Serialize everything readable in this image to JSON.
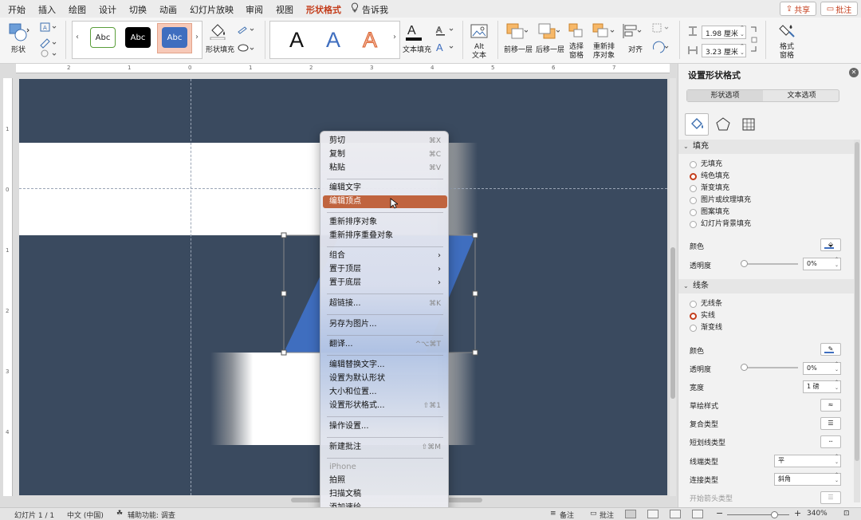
{
  "tabs": [
    "开始",
    "插入",
    "绘图",
    "设计",
    "切换",
    "动画",
    "幻灯片放映",
    "审阅",
    "视图",
    "形状格式",
    "告诉我"
  ],
  "active_tab": "形状格式",
  "header_buttons": {
    "share": "共享",
    "comment": "批注"
  },
  "ribbon": {
    "shape_label": "形状",
    "style_swatches": [
      "Abc",
      "Abc",
      "Abc"
    ],
    "shape_fill_label": "形状填充",
    "wordart_letters": [
      "A",
      "A",
      "A"
    ],
    "text_fill_label": "文本填充",
    "alt_text_label": [
      "Alt",
      "文本"
    ],
    "bring_forward": "前移一层",
    "send_backward": "后移一层",
    "selection_pane": [
      "选择",
      "窗格"
    ],
    "reorder_objects": [
      "重新排",
      "序对象"
    ],
    "align": "对齐",
    "height_value": "1.98 厘米",
    "width_value": "3.23 厘米",
    "format_pane": [
      "格式",
      "窗格"
    ],
    "accent_color": "#c43e1c"
  },
  "context_menu": {
    "items": [
      {
        "label": "剪切",
        "shortcut": "⌘X"
      },
      {
        "label": "复制",
        "shortcut": "⌘C"
      },
      {
        "label": "粘贴",
        "shortcut": "⌘V"
      },
      {
        "label": "编辑文字",
        "shortcut": ""
      },
      {
        "label": "编辑顶点",
        "shortcut": "",
        "highlighted": true
      },
      {
        "label": "重新排序对象",
        "shortcut": ""
      },
      {
        "label": "重新排序重叠对象",
        "shortcut": ""
      },
      {
        "label": "组合",
        "shortcut": "",
        "submenu": true
      },
      {
        "label": "置于顶层",
        "shortcut": "",
        "submenu": true
      },
      {
        "label": "置于底层",
        "shortcut": "",
        "submenu": true
      },
      {
        "label": "超链接...",
        "shortcut": "⌘K"
      },
      {
        "label": "另存为图片...",
        "shortcut": ""
      },
      {
        "label": "翻译...",
        "shortcut": "^⌥⌘T"
      },
      {
        "label": "编辑替换文字...",
        "shortcut": ""
      },
      {
        "label": "设置为默认形状",
        "shortcut": ""
      },
      {
        "label": "大小和位置...",
        "shortcut": ""
      },
      {
        "label": "设置形状格式...",
        "shortcut": "⇧⌘1"
      },
      {
        "label": "操作设置...",
        "shortcut": ""
      },
      {
        "label": "新建批注",
        "shortcut": "⇧⌘M"
      },
      {
        "label": "iPhone",
        "shortcut": "",
        "disabled": true
      },
      {
        "label": "拍照",
        "shortcut": ""
      },
      {
        "label": "扫描文稿",
        "shortcut": ""
      },
      {
        "label": "添加速绘",
        "shortcut": ""
      }
    ]
  },
  "format_pane": {
    "title": "设置形状格式",
    "tabs": [
      "形状选项",
      "文本选项"
    ],
    "fill": {
      "header": "填充",
      "options": [
        "无填充",
        "纯色填充",
        "渐变填充",
        "图片或纹理填充",
        "图案填充",
        "幻灯片背景填充"
      ],
      "selected": 1,
      "color_label": "颜色",
      "transparency_label": "透明度",
      "transparency_value": "0%"
    },
    "line": {
      "header": "线条",
      "options": [
        "无线条",
        "实线",
        "渐变线"
      ],
      "selected": 1,
      "color_label": "颜色",
      "transparency_label": "透明度",
      "transparency_value": "0%",
      "width_label": "宽度",
      "width_value": "1 磅",
      "sketch_label": "草绘样式",
      "compound_label": "复合类型",
      "dash_label": "短划线类型",
      "cap_label": "线端类型",
      "cap_value": "平",
      "join_label": "连接类型",
      "join_value": "斜角",
      "arrow_label": "开始箭头类型"
    }
  },
  "status_bar": {
    "slide_info": "幻灯片 1 / 1",
    "language": "中文 (中国)",
    "accessibility": "辅助功能: 调查",
    "notes": "备注",
    "comments": "批注",
    "zoom": "340%"
  }
}
